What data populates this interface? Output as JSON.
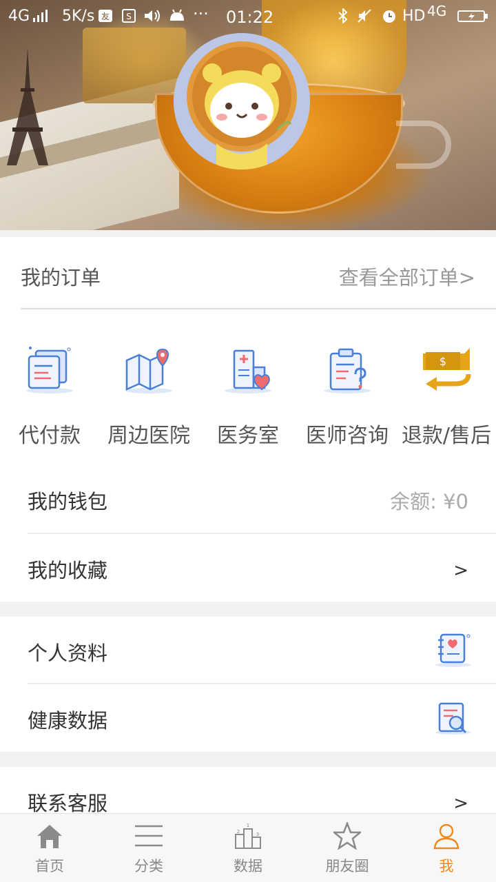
{
  "status_bar": {
    "network_left": "4G",
    "speed": "5K/s",
    "time": "01:22",
    "hd": "HD",
    "network_right": "4G",
    "icons": [
      "signal-icon",
      "app-icon",
      "app-icon",
      "volume-icon",
      "android-icon",
      "more-icon",
      "bluetooth-icon",
      "mute-icon",
      "alarm-icon",
      "battery-icon"
    ]
  },
  "profile": {
    "avatar_icon": "lion-avatar-icon"
  },
  "orders": {
    "title": "我的订单",
    "view_all": "查看全部订单>"
  },
  "shortcuts": [
    {
      "label": "代付款",
      "icon": "documents-icon"
    },
    {
      "label": "周边医院",
      "icon": "map-icon"
    },
    {
      "label": "医务室",
      "icon": "hospital-icon"
    },
    {
      "label": "医师咨询",
      "icon": "clipboard-question-icon"
    },
    {
      "label": "退款/售后",
      "icon": "refund-icon"
    }
  ],
  "menu": {
    "wallet": {
      "label": "我的钱包",
      "value": "余额: ¥0"
    },
    "favorites": {
      "label": "我的收藏",
      "chevron": ">"
    },
    "profile_info": {
      "label": "个人资料",
      "icon": "notebook-heart-icon"
    },
    "health_data": {
      "label": "健康数据",
      "icon": "document-search-icon"
    },
    "customer_service": {
      "label": "联系客服",
      "chevron": ">"
    }
  },
  "tabs": [
    {
      "label": "首页",
      "icon": "home-icon"
    },
    {
      "label": "分类",
      "icon": "list-icon"
    },
    {
      "label": "数据",
      "icon": "podium-icon"
    },
    {
      "label": "朋友圈",
      "icon": "star-icon"
    },
    {
      "label": "我",
      "icon": "user-icon",
      "active": true
    }
  ],
  "colors": {
    "accent": "#f08a1c",
    "icon_blue": "#4a7fd6",
    "icon_red": "#f06c6c"
  }
}
